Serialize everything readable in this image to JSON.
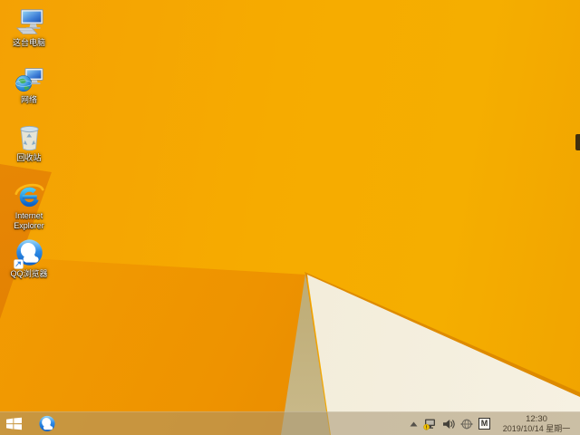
{
  "wallpaper": {
    "base_amber": "#f6ab00",
    "lower_left_orange": "#ee9300",
    "dark_wedge_orange": "#dc7800",
    "tan_facet": "#ab985e",
    "cream_facet": "#f2ecd9",
    "ridge_line": "#d98500"
  },
  "desktop_icons": [
    {
      "name": "this-pc",
      "label": "这台电脑"
    },
    {
      "name": "network",
      "label": "网络"
    },
    {
      "name": "recycle-bin",
      "label": "回收站"
    },
    {
      "name": "internet-explorer",
      "label": "Internet Explorer"
    },
    {
      "name": "qq-browser",
      "label": "QQ浏览器"
    }
  ],
  "taskbar": {
    "start_button_icon": "windows-logo-icon",
    "pinned_apps": [
      {
        "name": "qq-browser",
        "icon": "qq-browser-icon"
      }
    ],
    "tray": {
      "show_hidden_icon": "chevron-up-icon",
      "network_icon": "network-warning-icon",
      "volume_icon": "speaker-icon",
      "security_icon": "globe-sphere-icon",
      "input_method_label": "M",
      "time": "12:30",
      "date": "2019/10/14 星期一"
    }
  }
}
